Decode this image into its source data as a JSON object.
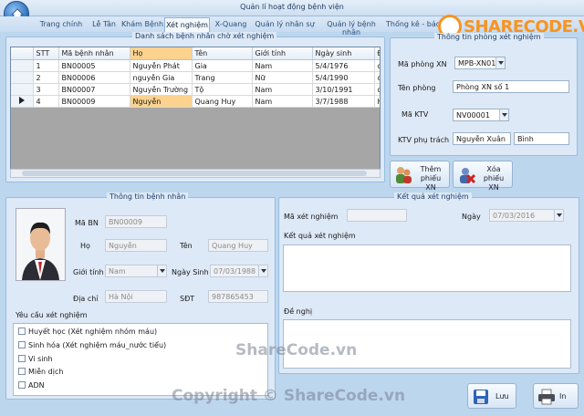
{
  "window": {
    "title": "Quản lí hoạt động bệnh viện"
  },
  "tabs": [
    "Trang chính",
    "Lễ Tân",
    "Khám Bệnh",
    "Xét nghiệm",
    "X-Quang",
    "Quản lý nhân sự",
    "Quản lý bệnh nhân",
    "Thống kê - báo"
  ],
  "brand": {
    "logo_text": "SHARECODE.VN",
    "accent": "#f79420"
  },
  "list_panel": {
    "legend": "Danh sách bệnh nhân chờ xét nghiệm",
    "columns": [
      "STT",
      "Mã bệnh nhân",
      "Họ",
      "Tên",
      "Giới tính",
      "Ngày sinh",
      "Đ"
    ],
    "rows": [
      {
        "stt": "1",
        "ma": "BN00005",
        "ho": "Nguyễn Phát",
        "ten": "Gia",
        "gt": "Nam",
        "ns": "5/4/1976",
        "dc": "đ"
      },
      {
        "stt": "2",
        "ma": "BN00006",
        "ho": "nguyễn Gia",
        "ten": "Trang",
        "gt": "Nữ",
        "ns": "5/4/1990",
        "dc": "đ"
      },
      {
        "stt": "3",
        "ma": "BN00007",
        "ho": "Nguyễn Trường",
        "ten": "Tộ",
        "gt": "Nam",
        "ns": "3/10/1991",
        "dc": "đ"
      },
      {
        "stt": "4",
        "ma": "BN00009",
        "ho": "Nguyễn",
        "ten": "Quang Huy",
        "gt": "Nam",
        "ns": "3/7/1988",
        "dc": "H"
      }
    ]
  },
  "lab_panel": {
    "legend": "Thông tin phòng xét nghiệm",
    "room_code_label": "Mã phòng XN",
    "room_code": "MPB-XN01",
    "room_name_label": "Tên phòng",
    "room_name": "Phòng XN số 1",
    "tech_code_label": "Mã KTV",
    "tech_code": "NV00001",
    "tech_name_label": "KTV phụ trách",
    "tech_first": "Nguyễn Xuân",
    "tech_last": "Bình"
  },
  "actions": {
    "add_label": "Thêm phiếu XN",
    "delete_label": "Xóa phiếu XN",
    "save_label": "Lưu",
    "print_label": "In"
  },
  "patient_panel": {
    "legend": "Thông tin bệnh nhân",
    "id_label": "Mã BN",
    "id": "BN00009",
    "ho_label": "Họ",
    "ho": "Nguyễn",
    "ten_label": "Tên",
    "ten": "Quang Huy",
    "gender_label": "Giới tính",
    "gender": "Nam",
    "dob_label": "Ngày Sinh",
    "dob": "07/03/1988",
    "address_label": "Địa chỉ",
    "address": "Hà Nội",
    "phone_label": "SĐT",
    "phone": "987865453",
    "request_label": "Yêu cầu xét nghiệm",
    "tests": [
      "Huyết học (Xét nghiệm nhóm máu)",
      "Sinh hóa (Xét nghiệm máu_nước tiểu)",
      "Vi sinh",
      "Miễn dịch",
      "ADN"
    ]
  },
  "result_panel": {
    "legend": "Kết quả xét nghiệm",
    "code_label": "Mã xét nghiệm",
    "code": "",
    "date_label": "Ngày",
    "date": "07/03/2016",
    "result_label": "Kết quả xét nghiệm",
    "suggest_label": "Đề nghị"
  },
  "watermarks": {
    "mid": "ShareCode.vn",
    "bottom": "Copyright © ShareCode.vn"
  }
}
